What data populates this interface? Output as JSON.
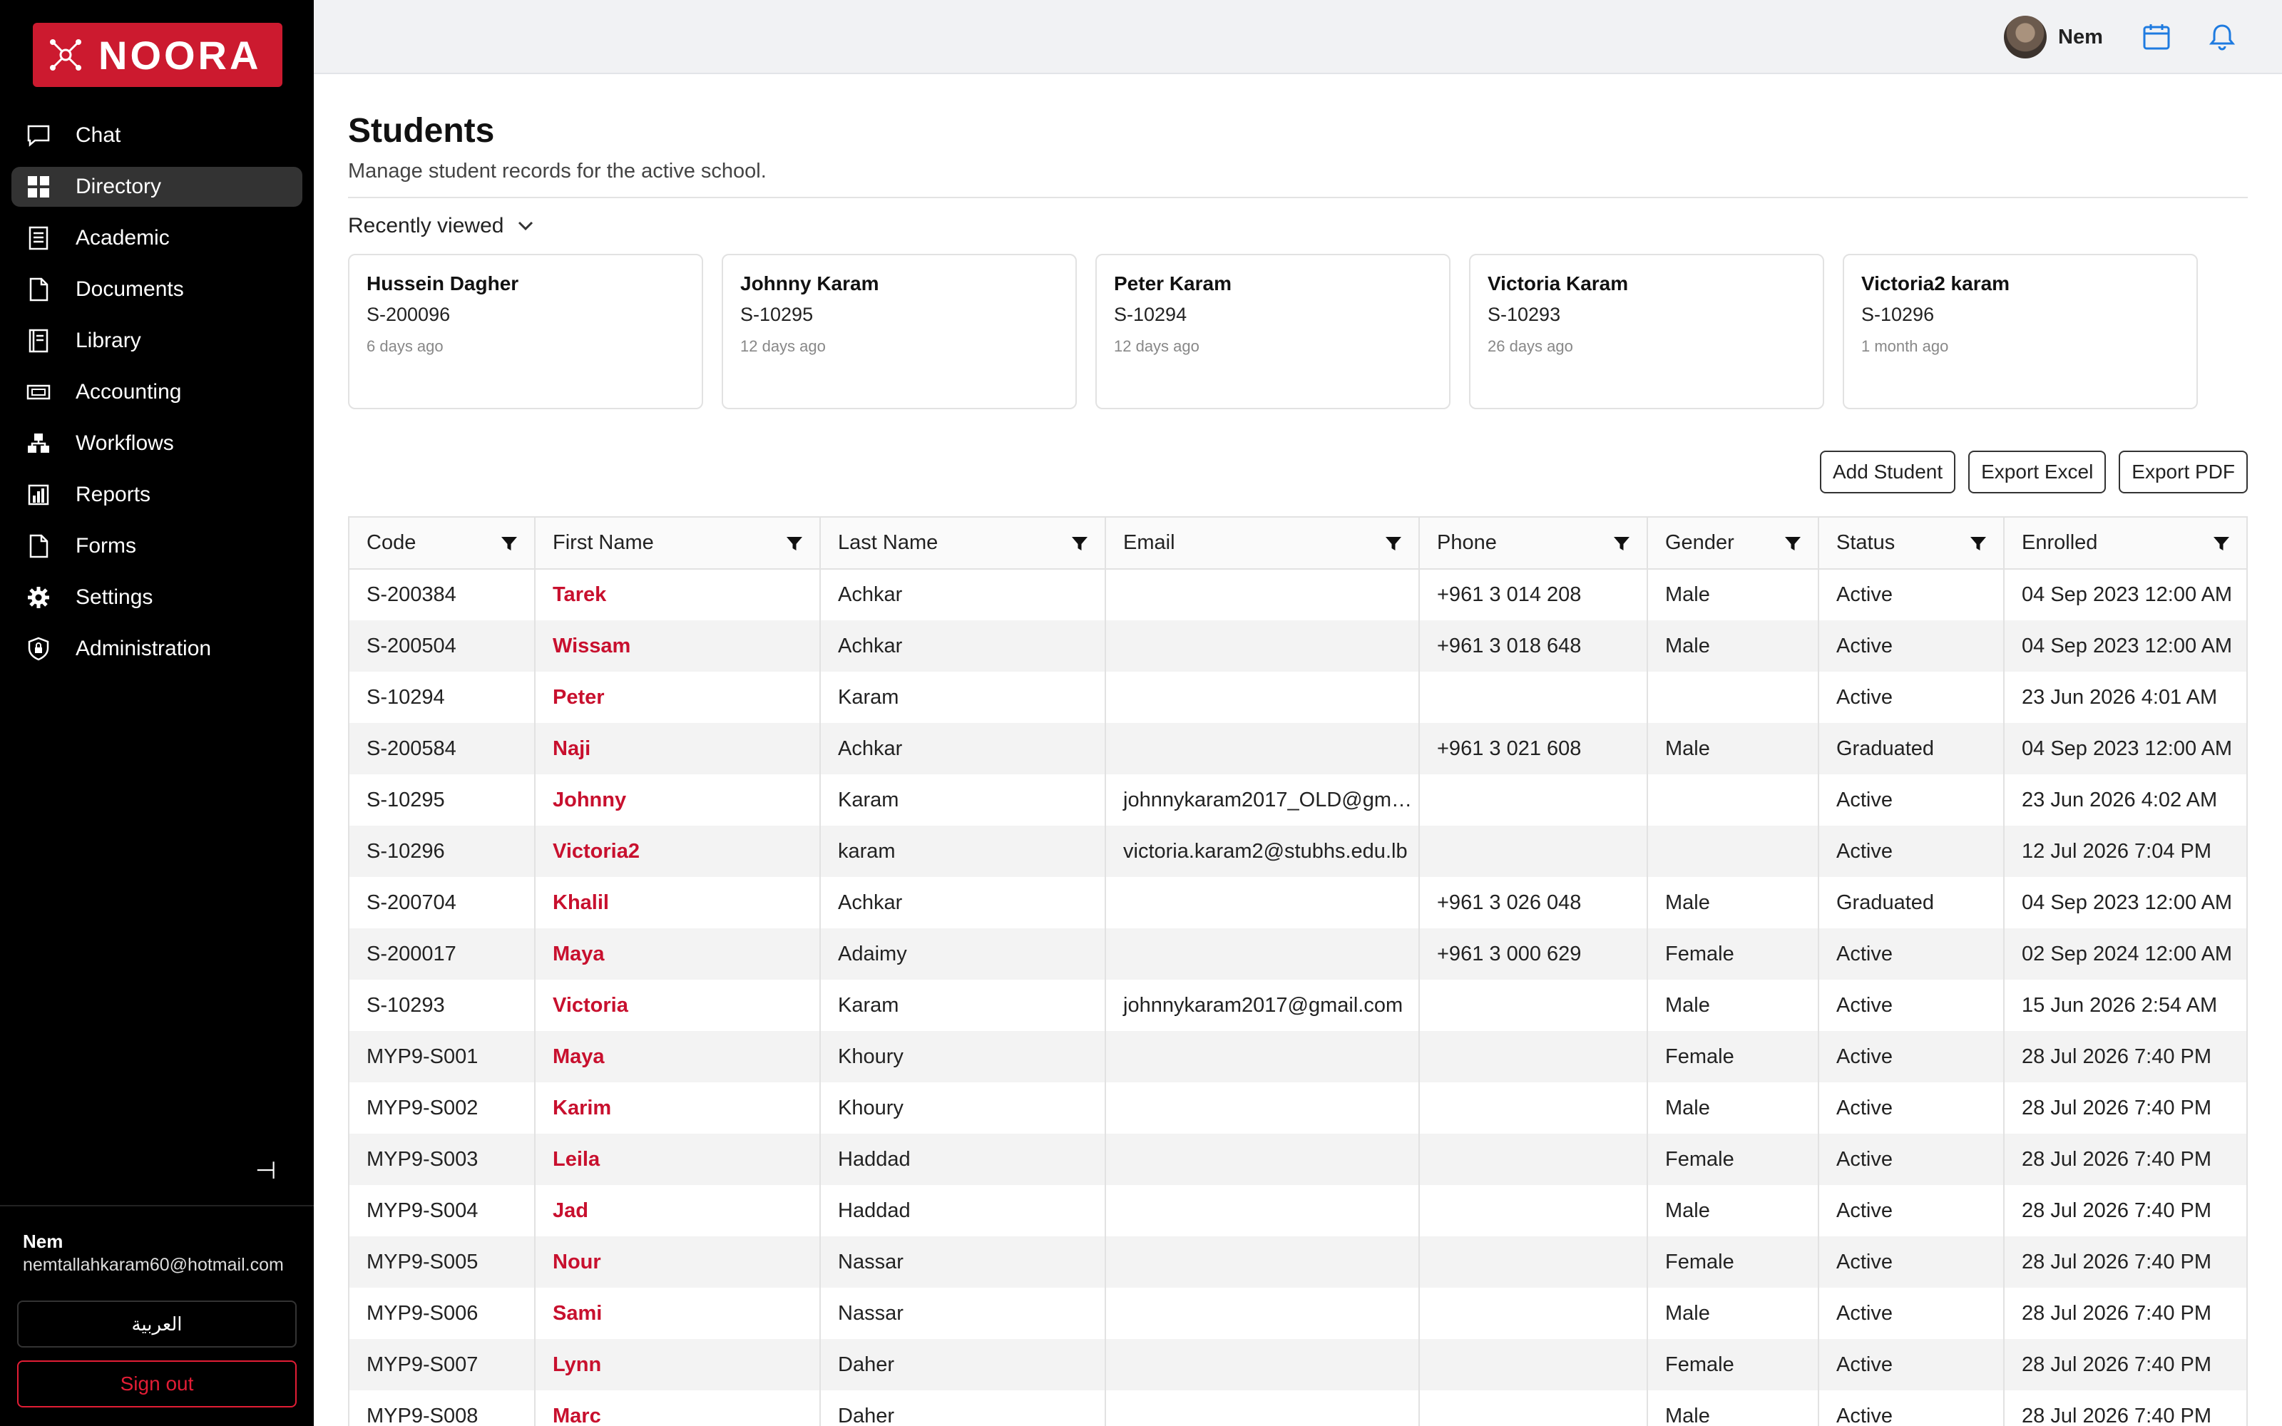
{
  "brand": {
    "name": "NOORA",
    "color": "#cc1a2f"
  },
  "sidebar": {
    "items": [
      {
        "label": "Chat",
        "icon": "chat-icon",
        "active": false
      },
      {
        "label": "Directory",
        "icon": "grid-icon",
        "active": true
      },
      {
        "label": "Academic",
        "icon": "notebook-icon",
        "active": false
      },
      {
        "label": "Documents",
        "icon": "document-icon",
        "active": false
      },
      {
        "label": "Library",
        "icon": "book-icon",
        "active": false
      },
      {
        "label": "Accounting",
        "icon": "money-icon",
        "active": false
      },
      {
        "label": "Workflows",
        "icon": "workflow-icon",
        "active": false
      },
      {
        "label": "Reports",
        "icon": "bar-chart-icon",
        "active": false
      },
      {
        "label": "Forms",
        "icon": "form-icon",
        "active": false
      },
      {
        "label": "Settings",
        "icon": "gear-icon",
        "active": false
      },
      {
        "label": "Administration",
        "icon": "shield-icon",
        "active": false
      }
    ],
    "user_name": "Nem",
    "user_email": "nemtallahkaram60@hotmail.com",
    "language_label": "العربية",
    "signout_label": "Sign out"
  },
  "topbar": {
    "user_name": "Nem"
  },
  "page": {
    "title": "Students",
    "subtitle": "Manage student records for the active school.",
    "recent_label": "Recently viewed"
  },
  "recent": [
    {
      "name": "Hussein Dagher",
      "code": "S-200096",
      "time": "6 days ago"
    },
    {
      "name": "Johnny Karam",
      "code": "S-10295",
      "time": "12 days ago"
    },
    {
      "name": "Peter Karam",
      "code": "S-10294",
      "time": "12 days ago"
    },
    {
      "name": "Victoria Karam",
      "code": "S-10293",
      "time": "26 days ago"
    },
    {
      "name": "Victoria2 karam",
      "code": "S-10296",
      "time": "1 month ago"
    }
  ],
  "actions": {
    "add": "Add Student",
    "excel": "Export Excel",
    "pdf": "Export PDF"
  },
  "table": {
    "columns": [
      "Code",
      "First Name",
      "Last Name",
      "Email",
      "Phone",
      "Gender",
      "Status",
      "Enrolled"
    ],
    "rows": [
      [
        "S-200384",
        "Tarek",
        "Achkar",
        "",
        "+961 3 014 208",
        "Male",
        "Active",
        "04 Sep 2023 12:00 AM"
      ],
      [
        "S-200504",
        "Wissam",
        "Achkar",
        "",
        "+961 3 018 648",
        "Male",
        "Active",
        "04 Sep 2023 12:00 AM"
      ],
      [
        "S-10294",
        "Peter",
        "Karam",
        "",
        "",
        "",
        "Active",
        "23 Jun 2026 4:01 AM"
      ],
      [
        "S-200584",
        "Naji",
        "Achkar",
        "",
        "+961 3 021 608",
        "Male",
        "Graduated",
        "04 Sep 2023 12:00 AM"
      ],
      [
        "S-10295",
        "Johnny",
        "Karam",
        "johnnykaram2017_OLD@gma...",
        "",
        "",
        "Active",
        "23 Jun 2026 4:02 AM"
      ],
      [
        "S-10296",
        "Victoria2",
        "karam",
        "victoria.karam2@stubhs.edu.lb",
        "",
        "",
        "Active",
        "12 Jul 2026 7:04 PM"
      ],
      [
        "S-200704",
        "Khalil",
        "Achkar",
        "",
        "+961 3 026 048",
        "Male",
        "Graduated",
        "04 Sep 2023 12:00 AM"
      ],
      [
        "S-200017",
        "Maya",
        "Adaimy",
        "",
        "+961 3 000 629",
        "Female",
        "Active",
        "02 Sep 2024 12:00 AM"
      ],
      [
        "S-10293",
        "Victoria",
        "Karam",
        "johnnykaram2017@gmail.com",
        "",
        "Male",
        "Active",
        "15 Jun 2026 2:54 AM"
      ],
      [
        "MYP9-S001",
        "Maya",
        "Khoury",
        "",
        "",
        "Female",
        "Active",
        "28 Jul 2026 7:40 PM"
      ],
      [
        "MYP9-S002",
        "Karim",
        "Khoury",
        "",
        "",
        "Male",
        "Active",
        "28 Jul 2026 7:40 PM"
      ],
      [
        "MYP9-S003",
        "Leila",
        "Haddad",
        "",
        "",
        "Female",
        "Active",
        "28 Jul 2026 7:40 PM"
      ],
      [
        "MYP9-S004",
        "Jad",
        "Haddad",
        "",
        "",
        "Male",
        "Active",
        "28 Jul 2026 7:40 PM"
      ],
      [
        "MYP9-S005",
        "Nour",
        "Nassar",
        "",
        "",
        "Female",
        "Active",
        "28 Jul 2026 7:40 PM"
      ],
      [
        "MYP9-S006",
        "Sami",
        "Nassar",
        "",
        "",
        "Male",
        "Active",
        "28 Jul 2026 7:40 PM"
      ],
      [
        "MYP9-S007",
        "Lynn",
        "Daher",
        "",
        "",
        "Female",
        "Active",
        "28 Jul 2026 7:40 PM"
      ],
      [
        "MYP9-S008",
        "Marc",
        "Daher",
        "",
        "",
        "Male",
        "Active",
        "28 Jul 2026 7:40 PM"
      ]
    ]
  }
}
